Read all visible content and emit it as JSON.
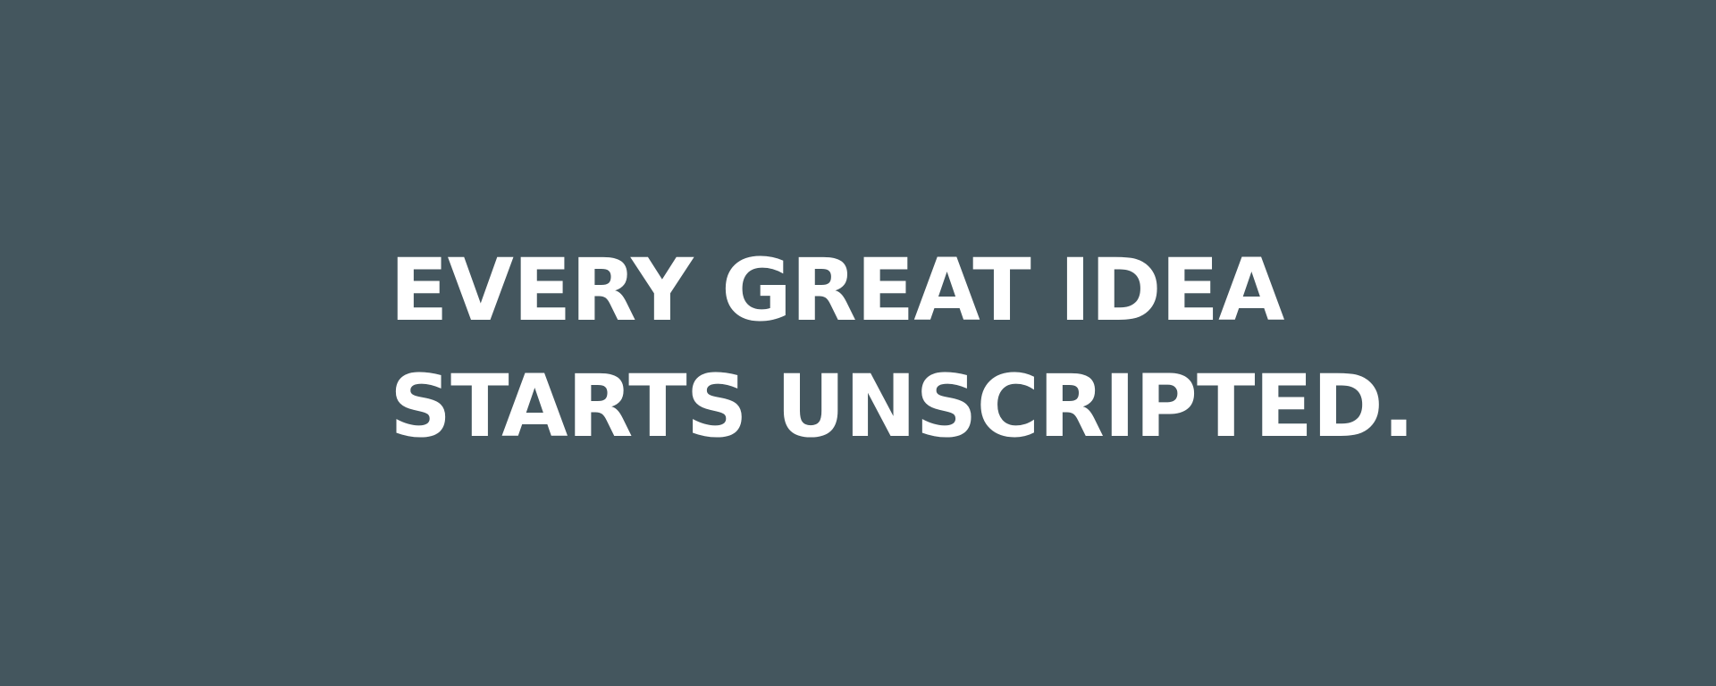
{
  "banner": {
    "background_color": "#44565e",
    "text_color": "#ffffff",
    "headline": {
      "line1": "EVERY GREAT IDEA",
      "line2": "STARTS UNSCRIPTED."
    }
  }
}
